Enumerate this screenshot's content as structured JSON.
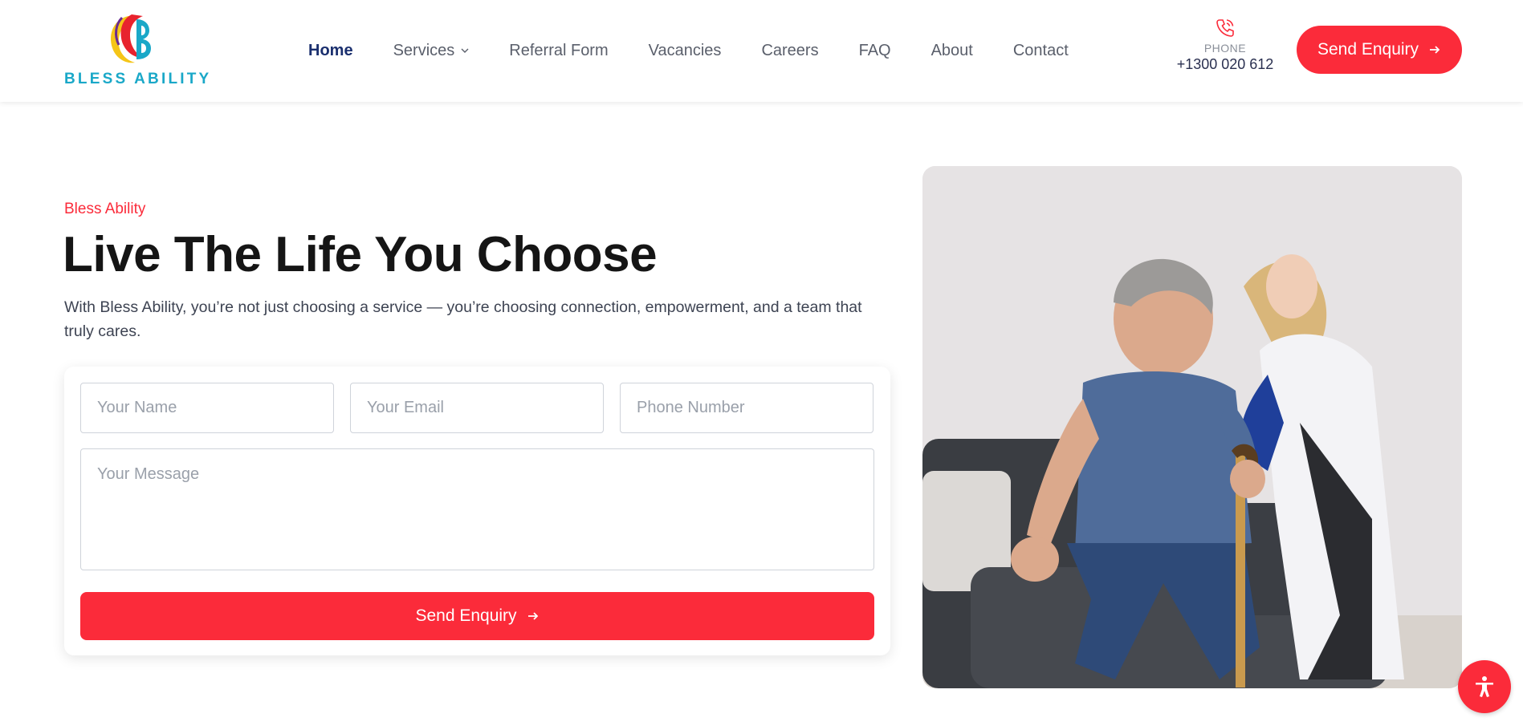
{
  "brand": {
    "name": "BLESS ABILITY",
    "accent": "#fb2b3a",
    "nav_active": "#1a2f6e",
    "logo_text_color": "#1aa8c8"
  },
  "nav": {
    "items": [
      {
        "label": "Home",
        "active": true
      },
      {
        "label": "Services",
        "has_dropdown": true
      },
      {
        "label": "Referral Form"
      },
      {
        "label": "Vacancies"
      },
      {
        "label": "Careers"
      },
      {
        "label": "FAQ"
      },
      {
        "label": "About"
      },
      {
        "label": "Contact"
      }
    ]
  },
  "contact": {
    "label": "PHONE",
    "number": "+1300 020 612",
    "icon": "phone-icon"
  },
  "header_cta": {
    "label": "Send Enquiry",
    "icon": "arrow-right-icon"
  },
  "hero": {
    "eyebrow": "Bless Ability",
    "title": "Live The Life You Choose",
    "description": "With Bless Ability, you’re not just choosing a service — you’re choosing connection, empowerment, and a team that truly cares."
  },
  "form": {
    "name_placeholder": "Your Name",
    "email_placeholder": "Your Email",
    "phone_placeholder": "Phone Number",
    "message_placeholder": "Your Message",
    "submit_label": "Send Enquiry"
  },
  "photo": {
    "icon": "caregiver-photo"
  },
  "accessibility": {
    "icon": "accessibility-icon"
  }
}
